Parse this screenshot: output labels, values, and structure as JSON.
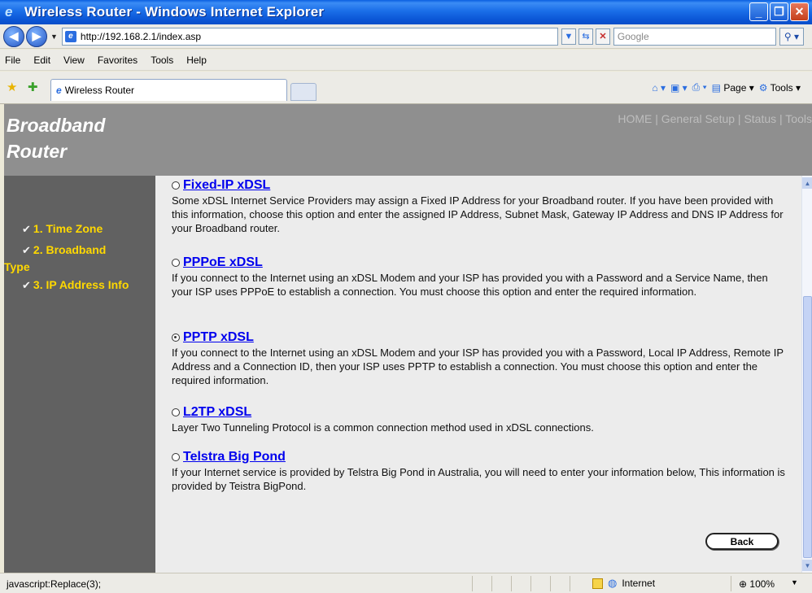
{
  "window": {
    "title": "Wireless Router - Windows Internet Explorer",
    "controls": {
      "minimize": "_",
      "maximize": "❐",
      "close": "✕"
    }
  },
  "address_bar": {
    "url": "http://192.168.2.1/index.asp",
    "search_placeholder": "Google"
  },
  "menu": {
    "items": [
      "File",
      "Edit",
      "View",
      "Favorites",
      "Tools",
      "Help"
    ]
  },
  "tabs": {
    "active_label": "Wireless Router"
  },
  "command_bar": {
    "page_label": "Page",
    "tools_label": "Tools"
  },
  "header": {
    "brand_line1": "Broadband",
    "brand_line2": "Router",
    "nav": "HOME | General Setup | Status | Tools"
  },
  "sidebar": {
    "steps": [
      {
        "label": "1. Time Zone"
      },
      {
        "label": "2. Broadband"
      },
      {
        "label": "Type"
      },
      {
        "label": "3. IP Address Info"
      }
    ]
  },
  "options": [
    {
      "label": "Fixed-IP xDSL",
      "selected": false,
      "description": "Some xDSL Internet Service Providers may assign a Fixed IP Address for your Broadband router. If you have been provided with this information, choose this option and enter the assigned IP Address, Subnet Mask, Gateway IP Address and DNS IP Address for your Broadband router."
    },
    {
      "label": "PPPoE xDSL",
      "selected": false,
      "description": "If you connect to the Internet using an xDSL Modem and your ISP has provided you with a Password and a Service Name, then your ISP uses PPPoE to establish a connection. You must choose this option and enter the required information."
    },
    {
      "label": "PPTP xDSL",
      "selected": true,
      "description": "If you connect to the Internet using an xDSL Modem and your ISP has provided you with a Password, Local IP Address, Remote IP Address and a Connection ID, then your ISP uses PPTP to establish a connection. You must choose this option and enter the required information."
    },
    {
      "label": "L2TP xDSL",
      "selected": false,
      "description": "Layer Two Tunneling Protocol is a common connection method used in xDSL connections."
    },
    {
      "label": "Telstra Big Pond",
      "selected": false,
      "description": "If your Internet service is provided by Telstra Big Pond in Australia, you will need to enter your information below, This information is provided by Teistra BigPond."
    }
  ],
  "buttons": {
    "back": "Back"
  },
  "status_bar": {
    "text": "javascript:Replace(3);",
    "zone": "Internet",
    "zoom": "100%"
  }
}
